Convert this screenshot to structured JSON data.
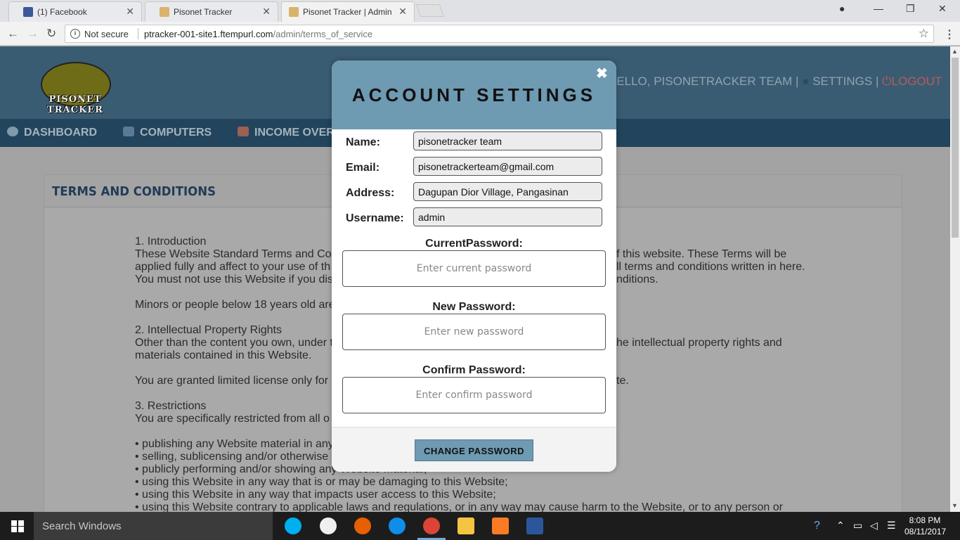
{
  "browser": {
    "tabs": [
      {
        "title": "(1) Facebook"
      },
      {
        "title": "Pisonet Tracker"
      },
      {
        "title": "Pisonet Tracker | Admin"
      }
    ],
    "security_label": "Not secure",
    "url_host": "ptracker-001-site1.ftempurl.com",
    "url_path": "/admin/terms_of_service"
  },
  "site": {
    "logo_text": "PISONET TRACKER",
    "greeting": "HELLO, PISONETRACKER TEAM",
    "settings_label": "SETTINGS",
    "logout_label": "LOGOUT",
    "nav": [
      {
        "label": "DASHBOARD"
      },
      {
        "label": "COMPUTERS"
      },
      {
        "label": "INCOME OVERVIEW"
      }
    ],
    "content_title": "TERMS AND CONDITIONS",
    "terms_lines": [
      "1. Introduction",
      "These Website Standard Terms and Co",
      "applied fully and affect to your use of th",
      "You must not use this Website if you dis",
      "",
      "Minors or people below 18 years old are",
      "",
      "2. Intellectual Property Rights",
      "Other than the content you own, under t",
      "materials contained in this Website.",
      "",
      "You are granted limited license only for",
      "",
      "3. Restrictions",
      "You are specifically restricted from all o",
      "",
      "• publishing any Website material in any",
      "• selling, sublicensing and/or otherwise",
      "• publicly performing and/or showing any Website material;",
      "• using this Website in any way that is or may be damaging to this Website;",
      "• using this Website in any way that impacts user access to this Website;",
      "• using this Website contrary to applicable laws and regulations, or in any way may cause harm to the Website, or to any person or"
    ],
    "terms_right": [
      {
        "line": 1,
        "text": "f this website. These Terms will be"
      },
      {
        "line": 2,
        "text": "ll terms and conditions written in here."
      },
      {
        "line": 3,
        "text": "nditions."
      },
      {
        "line": 8,
        "text": "he intellectual property rights and"
      },
      {
        "line": 11,
        "text": "te."
      }
    ]
  },
  "modal": {
    "title": "ACCOUNT SETTINGS",
    "close_symbol": "✖",
    "fields": {
      "name_label": "Name:",
      "name_value": "pisonetracker team",
      "email_label": "Email:",
      "email_value": "pisonetrackerteam@gmail.com",
      "address_label": "Address:",
      "address_value": "Dagupan Dior Village, Pangasinan",
      "username_label": "Username:",
      "username_value": "admin"
    },
    "current_password_label": "CurrentPassword:",
    "current_password_placeholder": "Enter current password",
    "new_password_label": "New Password:",
    "new_password_placeholder": "Enter new password",
    "confirm_password_label": "Confirm Password:",
    "confirm_password_placeholder": "Enter confirm password",
    "change_button": "CHANGE PASSWORD"
  },
  "taskbar": {
    "search_placeholder": "Search Windows",
    "time": "8:08 PM",
    "date": "08/11/2017"
  }
}
